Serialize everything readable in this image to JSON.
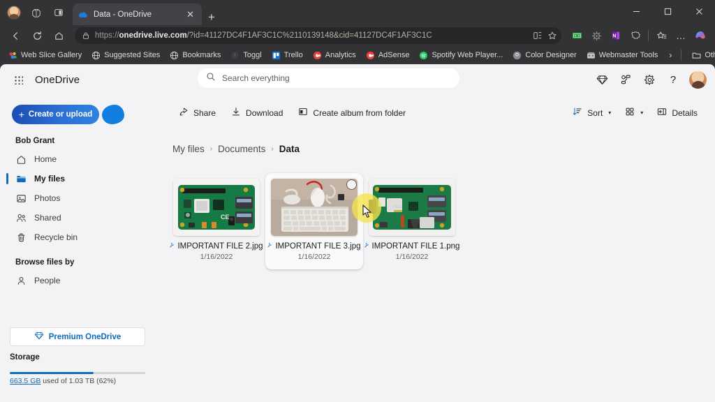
{
  "browser": {
    "tab": {
      "title": "Data - OneDrive",
      "favicon": "onedrive-cloud-icon",
      "close_label": "✕"
    },
    "new_tab_label": "+",
    "window_controls": {
      "minimize": "─",
      "maximize": "☐",
      "close": "✕"
    },
    "nav": {
      "back": "←",
      "refresh": "↻",
      "home": "⌂"
    },
    "address": {
      "scheme": "https://",
      "host": "onedrive.live.com",
      "path": "/?id=41127DC4F1AF3C1C%2110139148&cid=41127DC4F1AF3C1C",
      "lock_icon": "lock-icon",
      "split_icon": "split-screen-icon",
      "favorite_icon": "star-icon"
    },
    "extensions": [
      "money-extension-icon",
      "settings-extension-icon",
      "onenote-extension-icon",
      "browser-essentials-icon"
    ],
    "collections_icon": "favorites-icon",
    "more_icon": "…",
    "copilot_icon": "copilot-icon",
    "bookmarks": [
      {
        "label": "Web Slice Gallery",
        "icon": "web-slice-icon"
      },
      {
        "label": "Suggested Sites",
        "icon": "globe-icon"
      },
      {
        "label": "Bookmarks",
        "icon": "globe-icon"
      },
      {
        "label": "Toggl",
        "icon": "toggl-icon"
      },
      {
        "label": "Trello",
        "icon": "trello-icon"
      },
      {
        "label": "Analytics",
        "icon": "google-icon"
      },
      {
        "label": "AdSense",
        "icon": "google-icon"
      },
      {
        "label": "Spotify Web Player...",
        "icon": "spotify-icon"
      },
      {
        "label": "Color Designer",
        "icon": "color-designer-icon"
      },
      {
        "label": "Webmaster Tools",
        "icon": "webmaster-tools-icon"
      }
    ],
    "bookmarks_overflow": "›",
    "other_favourites": {
      "label": "Other favourites",
      "icon": "folder-icon"
    }
  },
  "header": {
    "waffle_icon": "app-launcher-icon",
    "brand": "OneDrive",
    "search": {
      "placeholder": "Search everything",
      "icon": "search-icon"
    },
    "icons": [
      {
        "name": "premium-diamond-icon"
      },
      {
        "name": "my-workflows-icon"
      },
      {
        "name": "gear-icon"
      },
      {
        "name": "help-icon",
        "glyph": "?"
      }
    ],
    "avatar": "account-avatar"
  },
  "actions": {
    "create_or_upload": {
      "label": "Create or upload",
      "plus": "+"
    },
    "commands": [
      {
        "label": "Share",
        "icon": "share-icon"
      },
      {
        "label": "Download",
        "icon": "download-icon"
      },
      {
        "label": "Create album from folder",
        "icon": "album-icon"
      }
    ],
    "sort": {
      "label": "Sort",
      "icon": "sort-icon",
      "chevron": "▾"
    },
    "view": {
      "icon": "tiles-view-icon",
      "chevron": "▾"
    },
    "details": {
      "label": "Details",
      "icon": "details-pane-icon"
    }
  },
  "sidebar": {
    "user": "Bob Grant",
    "items": [
      {
        "label": "Home",
        "icon": "home-icon",
        "active": false
      },
      {
        "label": "My files",
        "icon": "folder-icon",
        "active": true
      },
      {
        "label": "Photos",
        "icon": "photo-icon",
        "active": false
      },
      {
        "label": "Shared",
        "icon": "people-icon",
        "active": false
      },
      {
        "label": "Recycle bin",
        "icon": "trash-icon",
        "active": false
      }
    ],
    "browse_heading": "Browse files by",
    "browse_items": [
      {
        "label": "People",
        "icon": "person-icon"
      }
    ],
    "premium": {
      "label": "Premium OneDrive",
      "icon": "diamond-icon"
    },
    "storage": {
      "heading": "Storage",
      "used_link": "663.5 GB",
      "rest": " used of 1.03 TB (62%)",
      "percent": 62
    }
  },
  "breadcrumb": {
    "separator": "›",
    "items": [
      {
        "label": "My files",
        "current": false
      },
      {
        "label": "Documents",
        "current": false
      },
      {
        "label": "Data",
        "current": true
      }
    ]
  },
  "files": [
    {
      "name": "IMPORTANT FILE 2.jpg",
      "date": "1/16/2022",
      "thumb": "raspberry-pi-board",
      "selected": false
    },
    {
      "name": "IMPORTANT FILE 3.jpg",
      "date": "1/16/2022",
      "thumb": "keyboard-mouse-desk",
      "selected": true
    },
    {
      "name": "IMPORTANT FILE 1.png",
      "date": "1/16/2022",
      "thumb": "raspberry-pi-board-alt",
      "selected": false
    }
  ],
  "colors": {
    "accent": "#0f6cbd",
    "chrome_bg": "#333336",
    "page_bg": "#f3f2f4",
    "cursor_highlight": "#f5e44c"
  }
}
